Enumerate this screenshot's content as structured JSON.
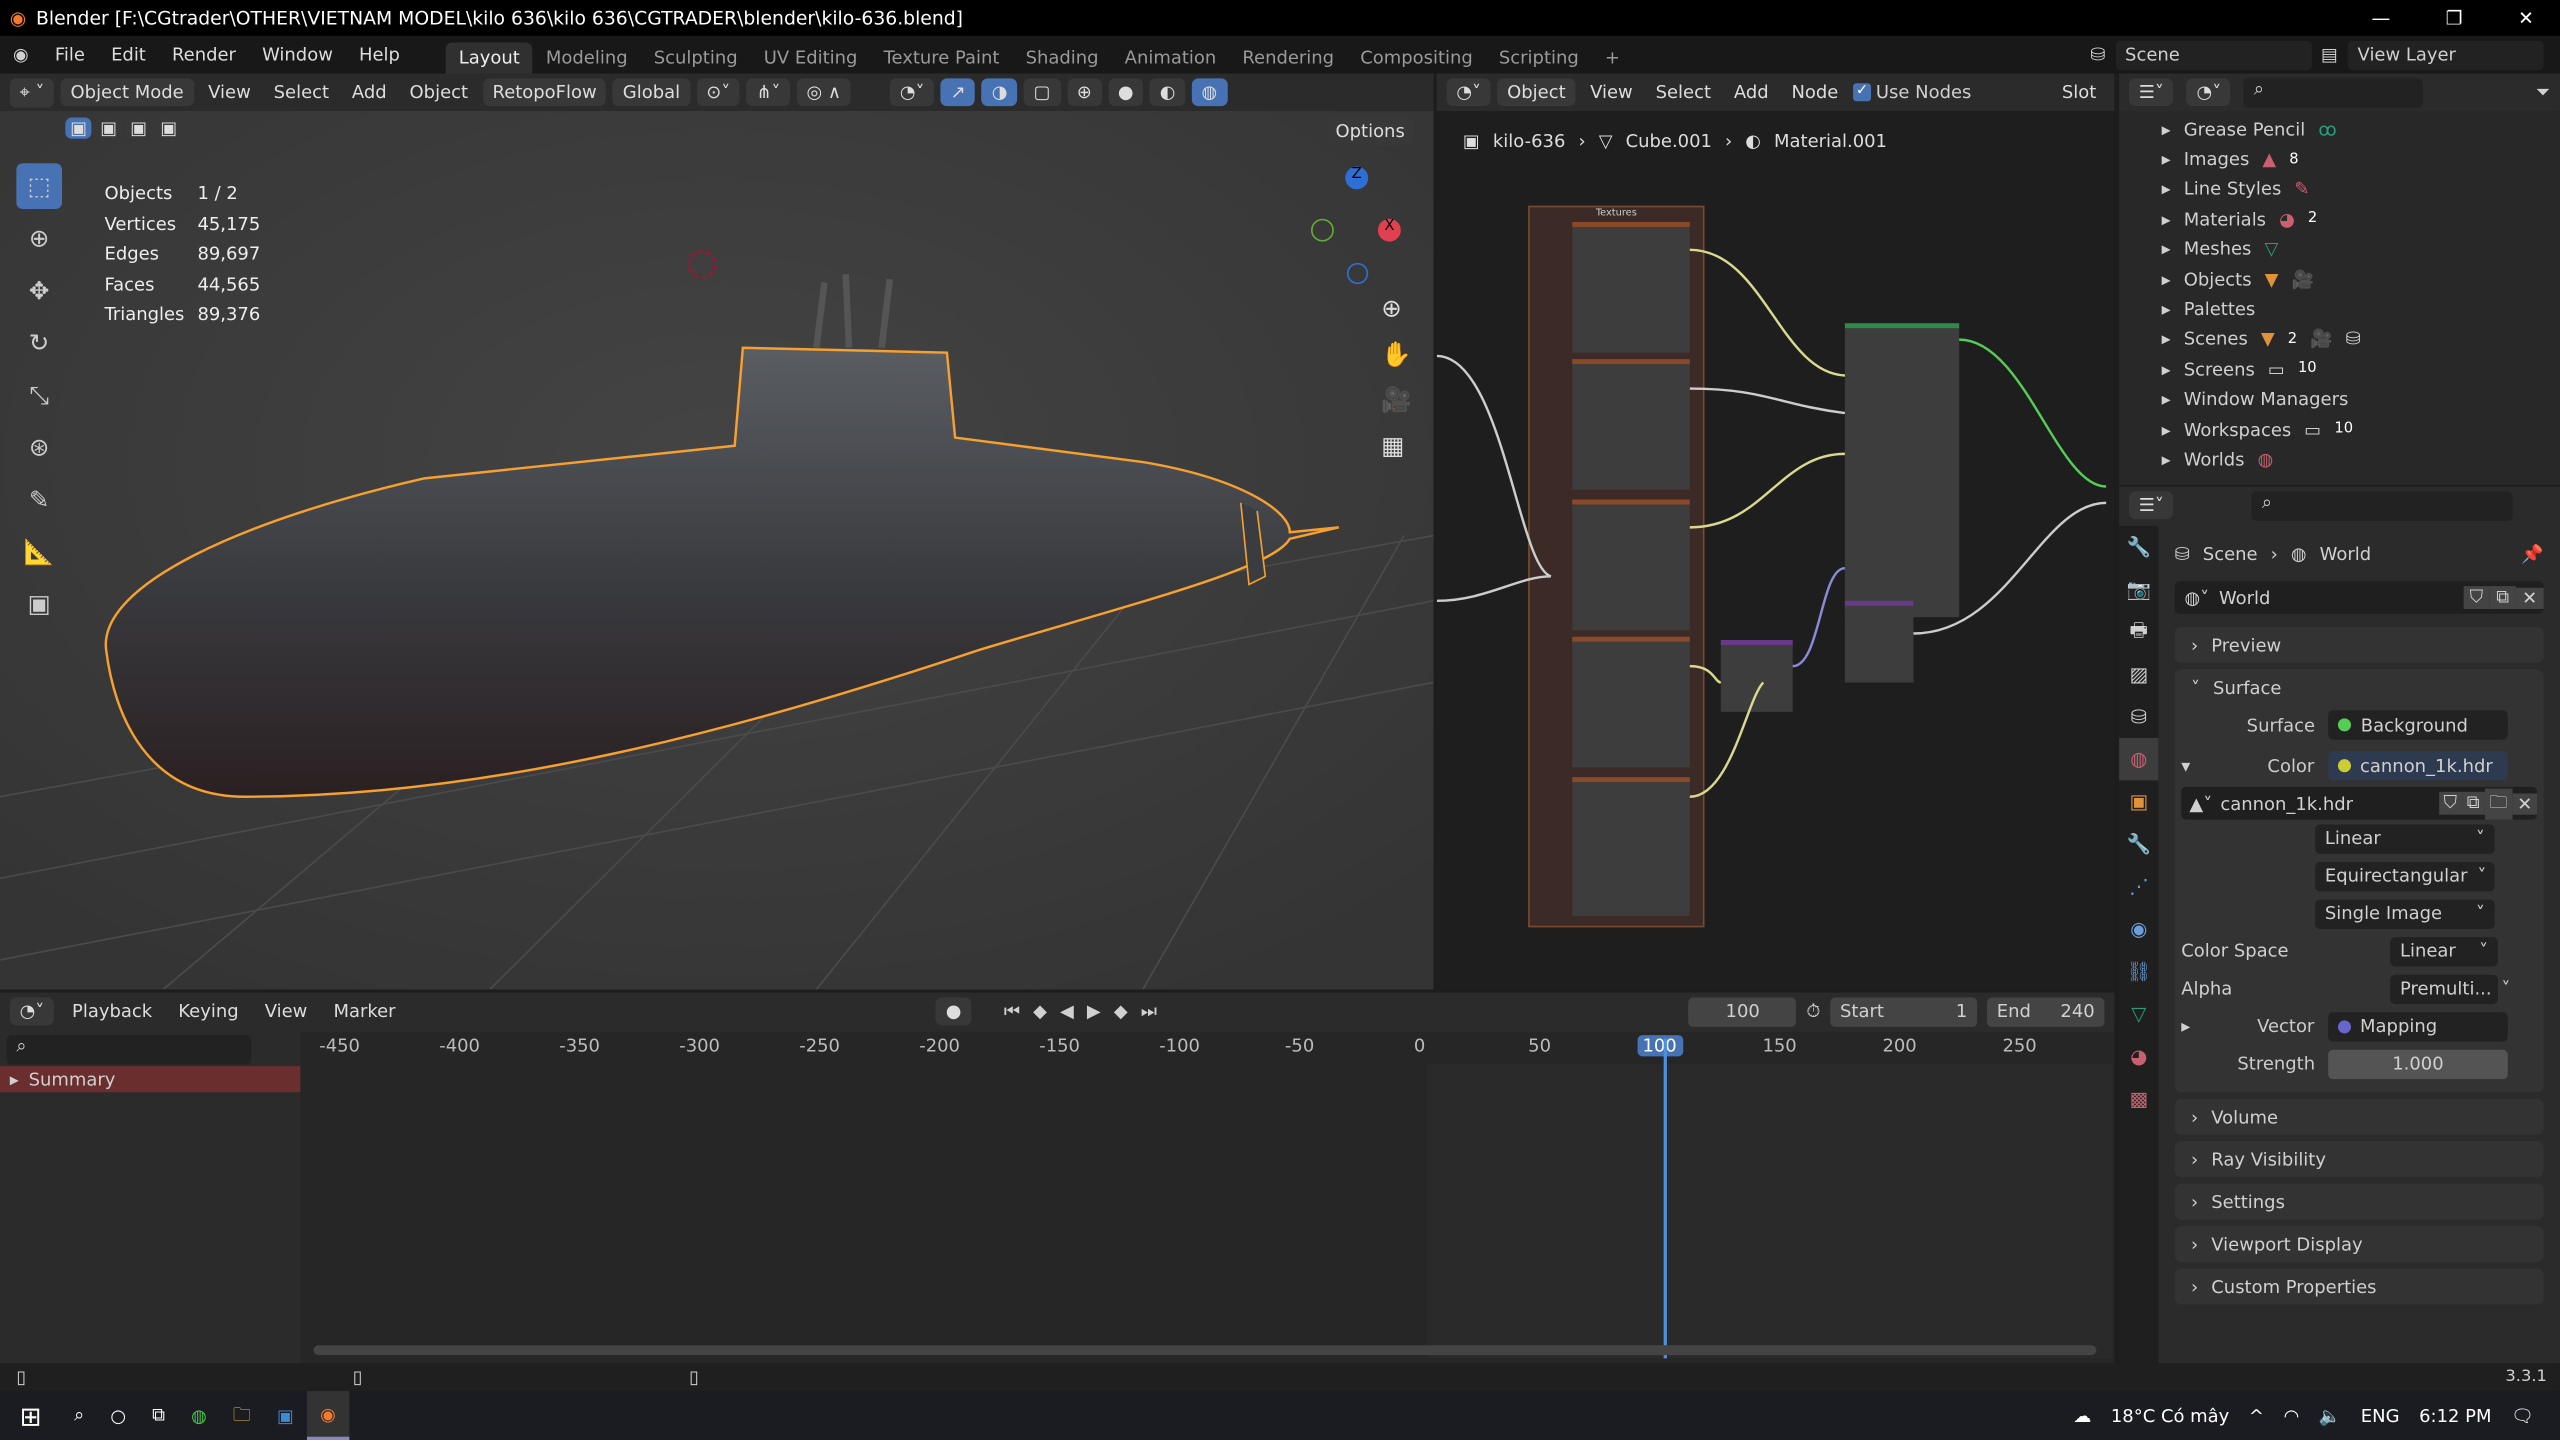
{
  "window": {
    "title": "Blender [F:\\CGtrader\\OTHER\\VIETNAM MODEL\\kilo 636\\kilo 636\\CGTRADER\\blender\\kilo-636.blend]"
  },
  "menu": [
    "File",
    "Edit",
    "Render",
    "Window",
    "Help"
  ],
  "workspaces": [
    "Layout",
    "Modeling",
    "Sculpting",
    "UV Editing",
    "Texture Paint",
    "Shading",
    "Animation",
    "Rendering",
    "Compositing",
    "Scripting",
    "+"
  ],
  "scene": "Scene",
  "view_layer": "View Layer",
  "viewport_header": {
    "mode": "Object Mode",
    "view": "View",
    "select": "Select",
    "add": "Add",
    "object": "Object",
    "addon": "RetopoFlow",
    "orientation": "Global",
    "options": "Options"
  },
  "stats": [
    {
      "label": "Objects",
      "value": "1 / 2"
    },
    {
      "label": "Vertices",
      "value": "45,175"
    },
    {
      "label": "Edges",
      "value": "89,697"
    },
    {
      "label": "Faces",
      "value": "44,565"
    },
    {
      "label": "Triangles",
      "value": "89,376"
    }
  ],
  "gizmo": {
    "z": "Z",
    "x": "X"
  },
  "node_header": {
    "type": "Object",
    "view": "View",
    "select": "Select",
    "add": "Add",
    "node": "Node",
    "use_nodes": "Use Nodes",
    "slot": "Slot"
  },
  "node_breadcrumb": [
    "kilo-636",
    "Cube.001",
    "Material.001"
  ],
  "node_frame_label": "Textures",
  "outliner": [
    {
      "label": "Grease Pencil",
      "count": ""
    },
    {
      "label": "Images",
      "count": "8"
    },
    {
      "label": "Line Styles",
      "count": ""
    },
    {
      "label": "Materials",
      "count": "2"
    },
    {
      "label": "Meshes",
      "count": ""
    },
    {
      "label": "Objects",
      "count": ""
    },
    {
      "label": "Palettes",
      "count": ""
    },
    {
      "label": "Scenes",
      "count": "2"
    },
    {
      "label": "Screens",
      "count": "10"
    },
    {
      "label": "Window Managers",
      "count": ""
    },
    {
      "label": "Workspaces",
      "count": "10"
    },
    {
      "label": "Worlds",
      "count": ""
    }
  ],
  "props": {
    "breadcrumb": [
      "Scene",
      "World"
    ],
    "world_name": "World",
    "panels": {
      "preview": "Preview",
      "surface": "Surface",
      "volume": "Volume",
      "ray_visibility": "Ray Visibility",
      "settings": "Settings",
      "viewport_display": "Viewport Display",
      "custom_properties": "Custom Properties"
    },
    "surface_label": "Surface",
    "surface_value": "Background",
    "color_label": "Color",
    "color_value": "cannon_1k.hdr",
    "image_name": "cannon_1k.hdr",
    "interpolation": "Linear",
    "projection": "Equirectangular",
    "source": "Single Image",
    "color_space_label": "Color Space",
    "color_space": "Linear",
    "alpha_label": "Alpha",
    "alpha": "Premulti...",
    "vector_label": "Vector",
    "vector_value": "Mapping",
    "strength_label": "Strength",
    "strength": "1.000"
  },
  "timeline": {
    "playback": "Playback",
    "keying": "Keying",
    "view": "View",
    "marker": "Marker",
    "current_frame": "100",
    "start_label": "Start",
    "start": "1",
    "end_label": "End",
    "end": "240",
    "ticks": [
      "-450",
      "-400",
      "-350",
      "-300",
      "-250",
      "-200",
      "-150",
      "-100",
      "-50",
      "0",
      "50",
      "100",
      "150",
      "200",
      "250"
    ],
    "summary": "Summary"
  },
  "status": {
    "version": "3.3.1"
  },
  "taskbar": {
    "weather": "18°C  Có mây",
    "lang": "ENG",
    "time": "6:12 PM"
  },
  "colors": {
    "accent": "#4772b3",
    "selection": "#f5a030"
  }
}
